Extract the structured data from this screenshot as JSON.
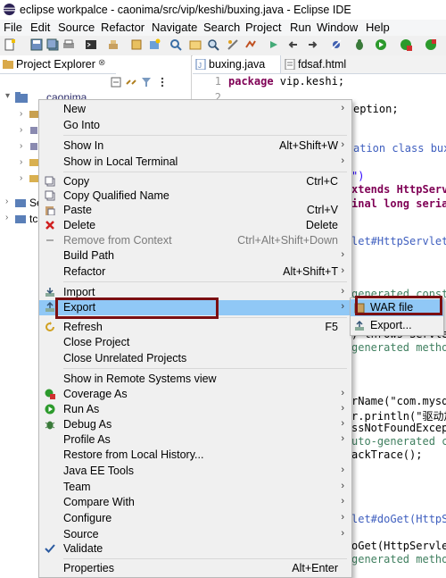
{
  "window": {
    "title": "eclipse workpalce - caonima/src/vip/keshi/buxing.java - Eclipse IDE"
  },
  "menubar": [
    "File",
    "Edit",
    "Source",
    "Refactor",
    "Navigate",
    "Search",
    "Project",
    "Run",
    "Window",
    "Help"
  ],
  "explorer": {
    "tab_label": "Project Explorer",
    "close": "⊗",
    "tree": {
      "project": "caonima",
      "item_se": "Se",
      "item_tc": "tc"
    }
  },
  "editor": {
    "tabs": [
      {
        "label": "buxing.java"
      },
      {
        "label": "fdsaf.html"
      }
    ],
    "lines": [
      {
        "n": "1",
        "kw": "package",
        "text": " vip.keshi;"
      },
      {
        "n": "2",
        "kw": "",
        "text": ""
      }
    ],
    "peek": [
      "eption;",
      "ation class buxin",
      "\")",
      "xtends HttpServl",
      "inal long serial",
      "let#HttpServlet()",
      "generated constr",
      ") throws Servle",
      "generated metho",
      "rName(\"com.mysql.",
      "r.println(\"驱动加",
      "ssNotFoundExcepti",
      "uto-generated ca",
      "ackTrace();",
      "let#doGet(HttpSer",
      "oGet(HttpServletR",
      "generated metho"
    ]
  },
  "context_menu": {
    "items": [
      {
        "label": "New",
        "arrow": true
      },
      {
        "label": "Go Into"
      },
      {
        "label": "Show In",
        "shortcut": "Alt+Shift+W",
        "arrow": true
      },
      {
        "label": "Show in Local Terminal",
        "arrow": true
      },
      {
        "label": "Copy",
        "shortcut": "Ctrl+C"
      },
      {
        "label": "Copy Qualified Name"
      },
      {
        "label": "Paste",
        "shortcut": "Ctrl+V"
      },
      {
        "label": "Delete",
        "shortcut": "Delete"
      },
      {
        "label": "Remove from Context",
        "shortcut": "Ctrl+Alt+Shift+Down",
        "disabled": true
      },
      {
        "label": "Build Path",
        "arrow": true
      },
      {
        "label": "Refactor",
        "shortcut": "Alt+Shift+T",
        "arrow": true
      },
      {
        "label": "Import",
        "arrow": true
      },
      {
        "label": "Export",
        "arrow": true,
        "highlighted": true
      },
      {
        "label": "Refresh",
        "shortcut": "F5"
      },
      {
        "label": "Close Project"
      },
      {
        "label": "Close Unrelated Projects"
      },
      {
        "label": "Show in Remote Systems view"
      },
      {
        "label": "Coverage As",
        "arrow": true
      },
      {
        "label": "Run As",
        "arrow": true
      },
      {
        "label": "Debug As",
        "arrow": true
      },
      {
        "label": "Profile As",
        "arrow": true
      },
      {
        "label": "Restore from Local History..."
      },
      {
        "label": "Java EE Tools",
        "arrow": true
      },
      {
        "label": "Team",
        "arrow": true
      },
      {
        "label": "Compare With",
        "arrow": true
      },
      {
        "label": "Configure",
        "arrow": true
      },
      {
        "label": "Source",
        "arrow": true
      },
      {
        "label": "Validate"
      },
      {
        "label": "Properties",
        "shortcut": "Alt+Enter"
      }
    ],
    "arrow_glyph": "›"
  },
  "submenu": {
    "items": [
      {
        "label": "WAR file",
        "highlighted": true
      },
      {
        "label": "Export..."
      }
    ]
  },
  "colors": {
    "highlight": "#90c8f6",
    "callout": "#7b0f12",
    "keyword": "#7f0055"
  }
}
